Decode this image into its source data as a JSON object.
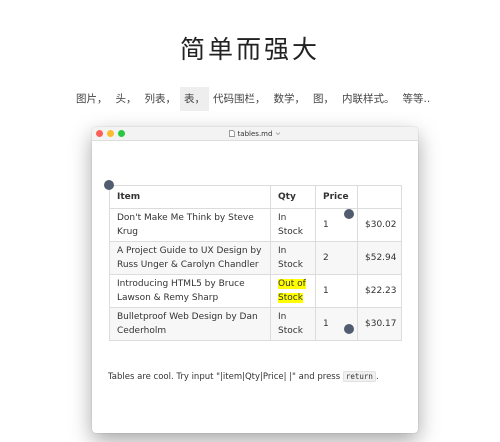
{
  "hero": {
    "title": "简单而强大"
  },
  "nav": {
    "items": [
      {
        "label": "图片，"
      },
      {
        "label": "头，"
      },
      {
        "label": "列表，"
      },
      {
        "label": "表，"
      },
      {
        "label": "代码围栏，"
      },
      {
        "label": "数学，"
      },
      {
        "label": "图，"
      },
      {
        "label": "内联样式。"
      },
      {
        "label": "等等.."
      }
    ],
    "active_index": 3
  },
  "window": {
    "title": "tables.md",
    "file_icon": "document-icon",
    "traffic_lights": {
      "close": "#fc5f57",
      "minimize": "#fdbc2e",
      "zoom": "#28c840"
    }
  },
  "table": {
    "headers": [
      "Item",
      "Qty",
      "Price",
      ""
    ],
    "rows": [
      {
        "item": "Don't Make Me Think by Steve Krug",
        "qty": "In Stock",
        "price": "1",
        "total": "$30.02"
      },
      {
        "item": "A Project Guide to UX Design by Russ Unger & Carolyn Chandler",
        "qty": "In Stock",
        "price": "2",
        "total": "$52.94"
      },
      {
        "item": "Introducing HTML5 by Bruce Lawson & Remy Sharp",
        "qty": "Out of Stock",
        "price": "1",
        "total": "$22.23"
      },
      {
        "item": "Bulletproof Web Design by Dan Cederholm",
        "qty": "In Stock",
        "price": "1",
        "total": "$30.17"
      }
    ]
  },
  "footer": {
    "text_before": "Tables are cool. Try input \"|item|Qty|Price| |\" and press ",
    "key": "return",
    "text_after": "."
  },
  "colors": {
    "highlight": "#ffff00",
    "cursor_dot": "#525c70"
  }
}
